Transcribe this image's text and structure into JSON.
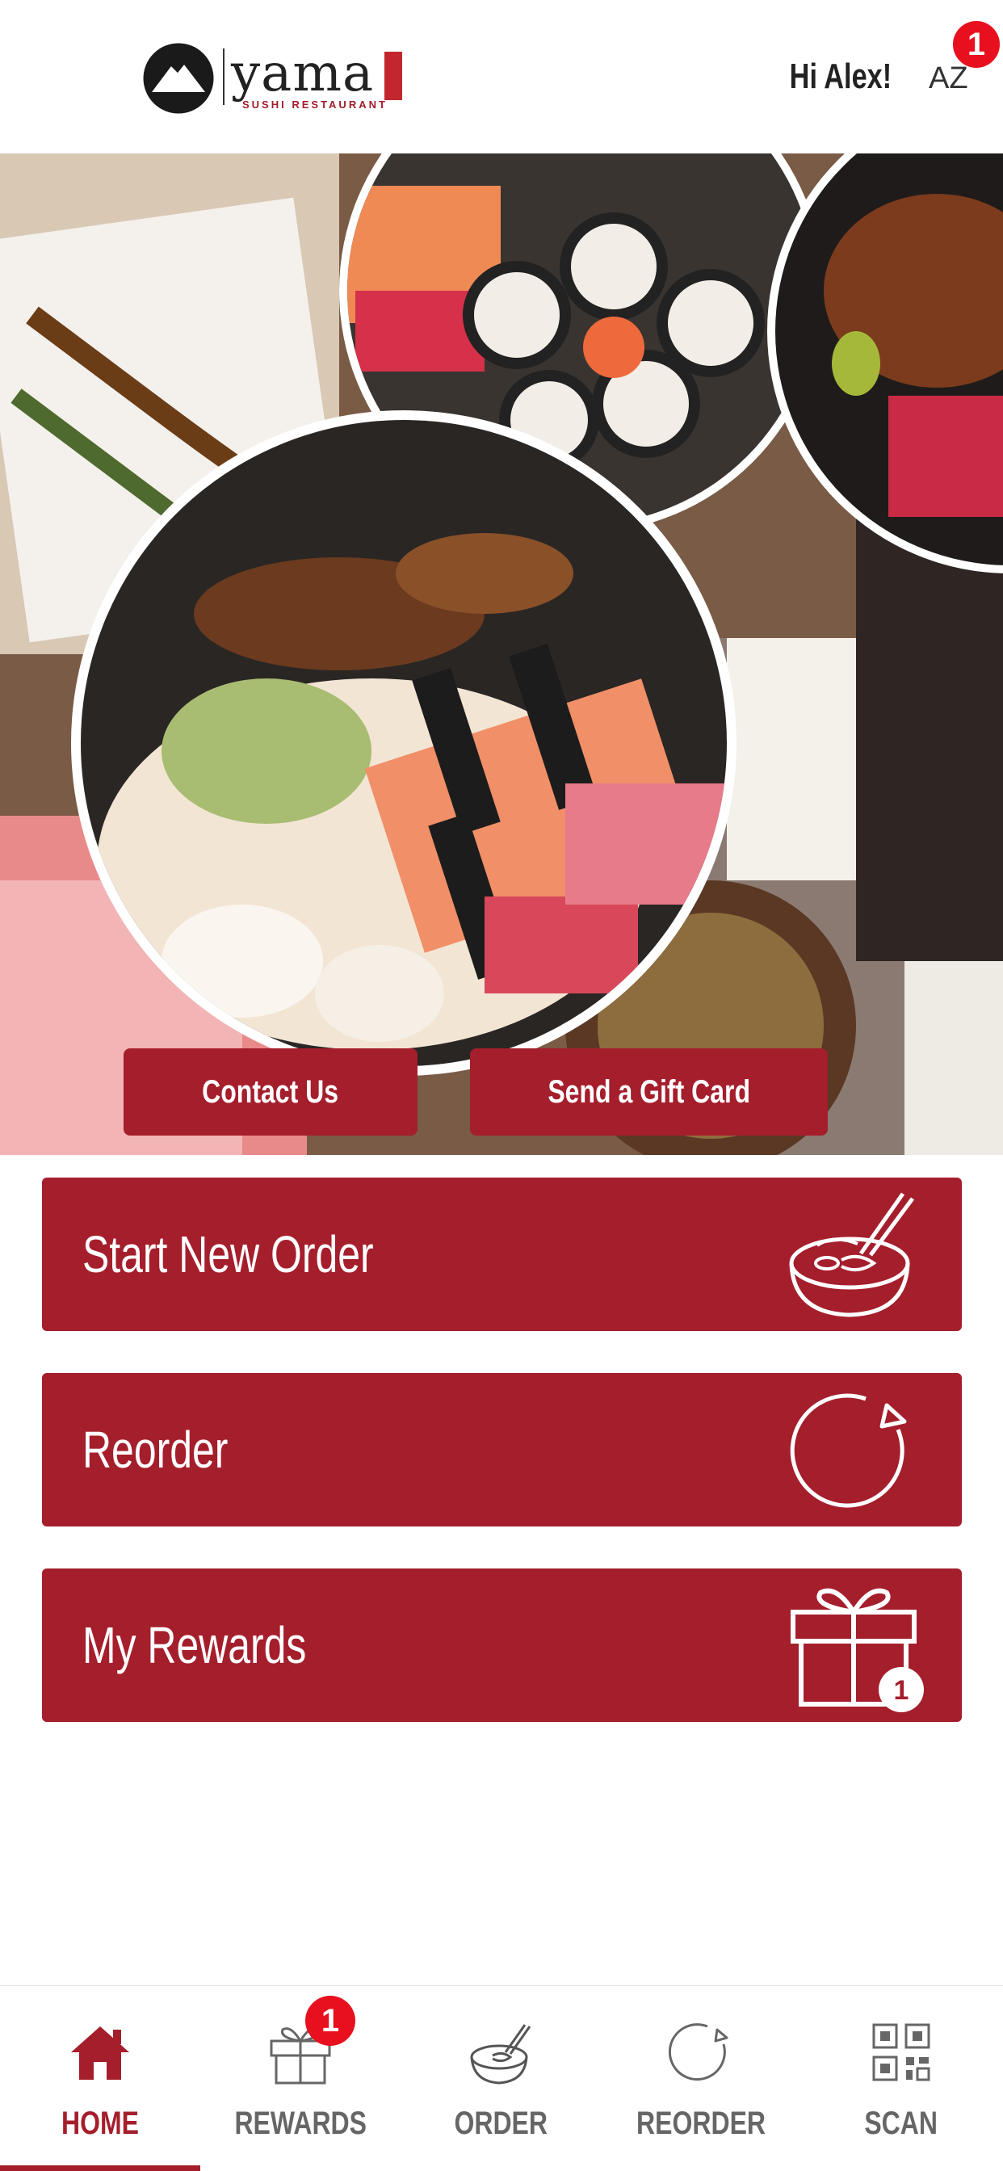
{
  "header": {
    "logo_text": "yama",
    "logo_subtitle": "SUSHI RESTAURANT",
    "greeting": "Hi Alex!",
    "user_initials": "AZ",
    "notification_count": "1"
  },
  "hero": {
    "contact_label": "Contact Us",
    "gift_card_label": "Send a Gift Card"
  },
  "actions": {
    "start_order": {
      "label": "Start New Order",
      "icon": "ramen-bowl-icon"
    },
    "reorder": {
      "label": "Reorder",
      "icon": "refresh-icon"
    },
    "rewards": {
      "label": "My Rewards",
      "icon": "gift-icon",
      "badge": "1"
    }
  },
  "bottom_nav": {
    "items": [
      {
        "label": "HOME",
        "icon": "home-icon",
        "active": true
      },
      {
        "label": "REWARDS",
        "icon": "gift-icon",
        "badge": "1"
      },
      {
        "label": "ORDER",
        "icon": "ramen-bowl-icon"
      },
      {
        "label": "REORDER",
        "icon": "refresh-icon"
      },
      {
        "label": "SCAN",
        "icon": "qr-code-icon"
      }
    ]
  },
  "colors": {
    "brand_red": "#a51e2c",
    "badge_red": "#e8101e"
  }
}
